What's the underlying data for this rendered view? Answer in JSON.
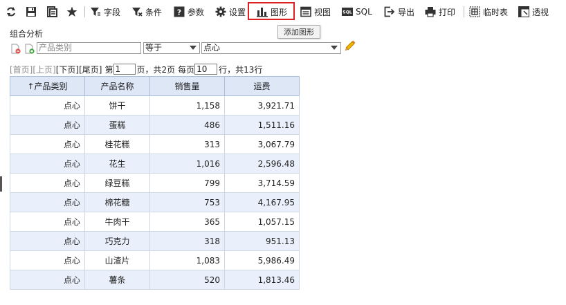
{
  "toolbar": {
    "items": [
      {
        "label": "",
        "icon": "refresh-icon"
      },
      {
        "label": "",
        "icon": "save-icon"
      },
      {
        "label": "",
        "icon": "save-as-icon"
      },
      {
        "label": "",
        "icon": "star-icon"
      },
      {
        "label": "字段",
        "icon": "field-filter-icon"
      },
      {
        "label": "条件",
        "icon": "condition-filter-icon"
      },
      {
        "label": "参数",
        "icon": "parameter-icon"
      },
      {
        "label": "设置",
        "icon": "gear-icon"
      },
      {
        "label": "图形",
        "icon": "bar-chart-icon"
      },
      {
        "label": "视图",
        "icon": "view-icon"
      },
      {
        "label": "SQL",
        "icon": "sql-icon"
      },
      {
        "label": "导出",
        "icon": "export-icon"
      },
      {
        "label": "打印",
        "icon": "print-icon"
      },
      {
        "label": "临时表",
        "icon": "temp-table-icon"
      },
      {
        "label": "透视",
        "icon": "pivot-icon"
      }
    ],
    "tooltip": "添加图形"
  },
  "panel_title": "组合分析",
  "filter": {
    "field_placeholder": "产品类别",
    "operator": "等于",
    "value": "点心"
  },
  "pager": {
    "first": "[首页]",
    "prev": "[上页]",
    "next": "[下页]",
    "last": "[尾页]",
    "page_prefix": "第",
    "page": "1",
    "page_suffix": "页，共2页",
    "size_prefix": "每页",
    "page_size": "10",
    "size_suffix": "行，共13行"
  },
  "table": {
    "sort_indicator": "↑",
    "columns": [
      "产品类别",
      "产品名称",
      "销售量",
      "运费"
    ],
    "rows": [
      [
        "点心",
        "饼干",
        "1,158",
        "3,921.71"
      ],
      [
        "点心",
        "蛋糕",
        "486",
        "1,511.16"
      ],
      [
        "点心",
        "桂花糕",
        "313",
        "3,067.79"
      ],
      [
        "点心",
        "花生",
        "1,016",
        "2,596.48"
      ],
      [
        "点心",
        "绿豆糕",
        "799",
        "3,714.59"
      ],
      [
        "点心",
        "棉花糖",
        "753",
        "4,167.95"
      ],
      [
        "点心",
        "牛肉干",
        "365",
        "1,057.15"
      ],
      [
        "点心",
        "巧克力",
        "318",
        "951.13"
      ],
      [
        "点心",
        "山渣片",
        "1,083",
        "5,986.49"
      ],
      [
        "点心",
        "薯条",
        "520",
        "1,813.46"
      ]
    ]
  }
}
